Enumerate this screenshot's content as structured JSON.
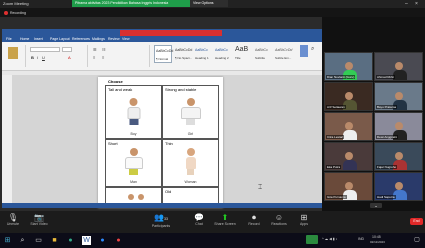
{
  "zoom_meeting": {
    "window_title": "Zoom Meeting",
    "banner_text": "Pitrama aktivitas 2023 Pendidikan Bahasa Inggris Indonesia",
    "view_options_label": "View Options",
    "recording_label": "Recording"
  },
  "word": {
    "ribbon_tabs": [
      "File",
      "Home",
      "Insert",
      "Page Layout",
      "References",
      "Mailings",
      "Review",
      "View"
    ],
    "styles": [
      "AaBbCcDd",
      "AaBbCcDd",
      "AaBbCc",
      "AaBbCc",
      "AaB",
      "AaBbCc",
      "AaBbCcDd"
    ],
    "style_names": [
      "¶ Normal",
      "¶ No Spaci...",
      "Heading 1",
      "Heading 2",
      "Title",
      "Subtitle",
      "Subtle Em..."
    ]
  },
  "document": {
    "page_heading": "Choose",
    "cells": [
      {
        "label": "Tall and weak",
        "caption": "Boy"
      },
      {
        "label": "Strong and stable",
        "caption": "Girl"
      },
      {
        "label": "Short",
        "caption": "Man"
      },
      {
        "label": "Thin",
        "caption": "Woman"
      },
      {
        "label": "",
        "caption": ""
      },
      {
        "label": "Old",
        "caption": ""
      }
    ]
  },
  "participants": [
    {
      "name": "Dian Novianti (Guru)"
    },
    {
      "name": "Ahmad Rizki"
    },
    {
      "name": "Arif Setiawan"
    },
    {
      "name": "Bayu Pratama"
    },
    {
      "name": "Citra Lestari"
    },
    {
      "name": "Dewi Anggraini"
    },
    {
      "name": "Eka Putra"
    },
    {
      "name": "Fajar Nugroho"
    },
    {
      "name": "Gita Purnama"
    },
    {
      "name": "Hadi Saputra"
    },
    {
      "name": "Indah Sari"
    },
    {
      "name": "Joko Susilo"
    }
  ],
  "controls": {
    "mute": "Unmute",
    "video": "Start Video",
    "participants": "Participants",
    "participants_count": "33",
    "chat": "Chat",
    "share": "Share Screen",
    "record": "Record",
    "reactions": "Reactions",
    "apps": "Apps",
    "end": "End"
  },
  "taskbar": {
    "time": "10:45",
    "date": "02/11/2023",
    "lang": "IND"
  }
}
